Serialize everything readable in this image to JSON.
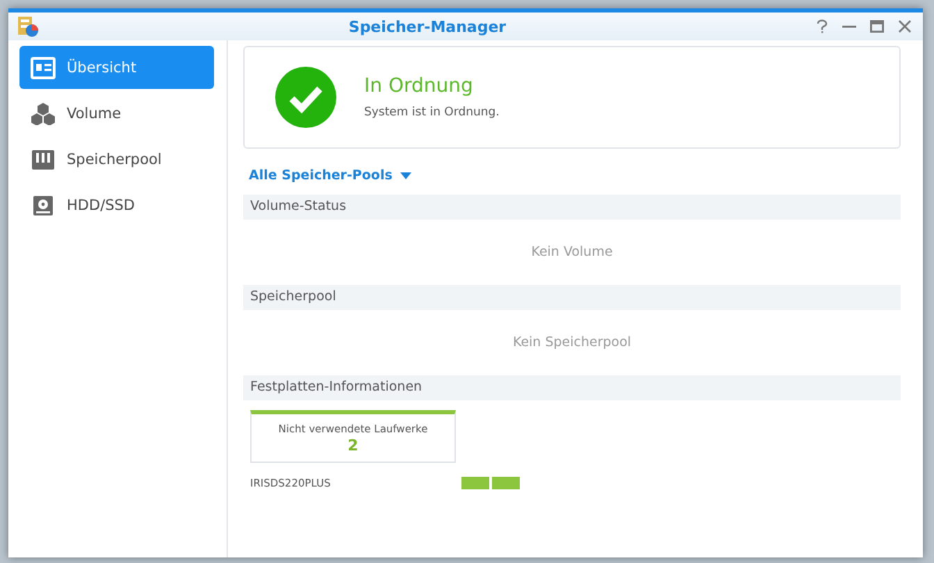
{
  "window": {
    "title": "Speicher-Manager"
  },
  "sidebar": {
    "items": [
      {
        "label": "Übersicht",
        "selected": true
      },
      {
        "label": "Volume",
        "selected": false
      },
      {
        "label": "Speicherpool",
        "selected": false
      },
      {
        "label": "HDD/SSD",
        "selected": false
      }
    ]
  },
  "status": {
    "title": "In Ordnung",
    "message": "System ist in Ordnung."
  },
  "pool_filter": {
    "label": "Alle Speicher-Pools"
  },
  "sections": [
    {
      "kind": "empty",
      "title": "Volume-Status",
      "message": "Kein Volume"
    },
    {
      "kind": "empty",
      "title": "Speicherpool",
      "message": "Kein Speicherpool"
    },
    {
      "kind": "disks",
      "title": "Festplatten-Informationen",
      "card": {
        "label": "Nicht verwendete Laufwerke",
        "value": "2"
      },
      "device": {
        "name": "IRISDS220PLUS",
        "drives": [
          {
            "color": "#8cc63f"
          },
          {
            "color": "#8cc63f"
          }
        ]
      }
    }
  ]
}
